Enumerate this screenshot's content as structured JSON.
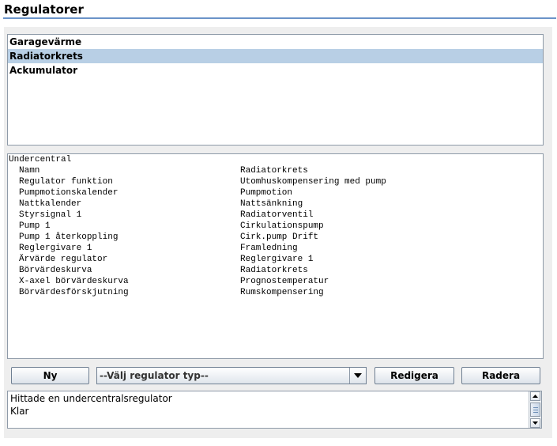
{
  "header": {
    "title": "Regulatorer"
  },
  "regulator_list": {
    "items": [
      "Garagevärme",
      "Radiatorkrets",
      "Ackumulator"
    ],
    "selected_index": 1
  },
  "details": {
    "header": "Undercentral",
    "rows": [
      {
        "key": "Namn",
        "value": "Radiatorkrets"
      },
      {
        "key": "Regulator funktion",
        "value": "Utomhuskompensering med pump"
      },
      {
        "key": "Pumpmotionskalender",
        "value": "Pumpmotion"
      },
      {
        "key": "Nattkalender",
        "value": "Nattsänkning"
      },
      {
        "key": "Styrsignal 1",
        "value": "Radiatorventil"
      },
      {
        "key": "Pump 1",
        "value": "Cirkulationspump"
      },
      {
        "key": "Pump 1 återkoppling",
        "value": "Cirk.pump Drift"
      },
      {
        "key": "Reglergivare 1",
        "value": "Framledning"
      },
      {
        "key": "Ärvärde regulator",
        "value": "Reglergivare 1"
      },
      {
        "key": "Börvärdeskurva",
        "value": "Radiatorkrets"
      },
      {
        "key": "X-axel börvärdeskurva",
        "value": "Prognostemperatur"
      },
      {
        "key": "Börvärdesförskjutning",
        "value": "Rumskompensering"
      }
    ]
  },
  "toolbar": {
    "new_label": "Ny",
    "type_select": "--Välj regulator typ--",
    "edit_label": "Redigera",
    "delete_label": "Radera"
  },
  "status": {
    "lines": [
      "Hittade en undercentralsregulator",
      "Klar"
    ]
  },
  "colors": {
    "accent": "#6b93c9",
    "selection": "#b8cfe5",
    "panel": "#eeeeee"
  },
  "icons": {
    "dropdown": "chevron-down-icon",
    "scroll_up": "arrow-up-icon",
    "scroll_down": "arrow-down-icon"
  }
}
